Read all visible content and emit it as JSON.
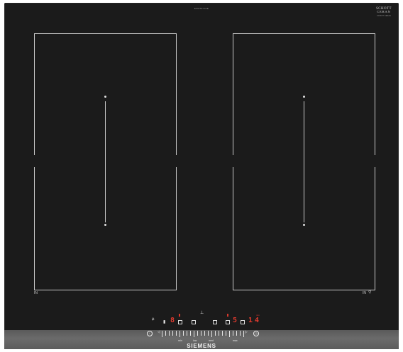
{
  "hob": {
    "model_text": "EX675LYC1E",
    "glass_brand": {
      "line1": "SCHOTT",
      "line2": "CERAN",
      "line3": "SCHOTT CERAN"
    },
    "zones": {
      "left": {
        "label": "IN"
      },
      "right": {
        "label": "IN",
        "icon": "pot-sensor-icon"
      }
    },
    "controls": {
      "left_timer_display": "8",
      "right_power_display": "5",
      "right_timer_display": "14",
      "right_timer_small": "min",
      "scale_labels": [
        "min",
        "low",
        "med",
        "max"
      ],
      "pan_icon": "pan-icon"
    },
    "brand": "SIEMENS",
    "colors": {
      "glass": "#1b1b1b",
      "lines": "#c9c9c9",
      "display": "#e03a2e",
      "strip": "#5f5f5f"
    }
  }
}
